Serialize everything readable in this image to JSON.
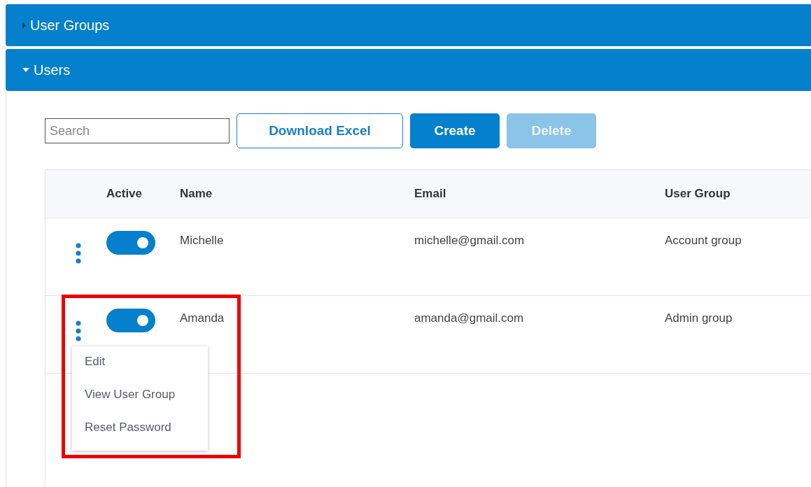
{
  "panels": [
    {
      "title": "User Groups",
      "expanded": false
    },
    {
      "title": "Users",
      "expanded": true
    }
  ],
  "toolbar": {
    "search": {
      "placeholder": "Search"
    },
    "buttons": [
      {
        "label": "Download Excel",
        "kind": "outline",
        "disabled": false
      },
      {
        "label": "Create",
        "kind": "primary",
        "disabled": false
      },
      {
        "label": "Delete",
        "kind": "primary",
        "disabled": true
      }
    ]
  },
  "table": {
    "columns": [
      "Active",
      "Name",
      "Email",
      "User Group"
    ],
    "rows": [
      {
        "active": true,
        "name": "Michelle",
        "email": "michelle@gmail.com",
        "group": "Account group",
        "highlighted": false
      },
      {
        "active": true,
        "name": "Amanda",
        "email": "amanda@gmail.com",
        "group": "Admin group",
        "highlighted": true,
        "menu": [
          "Edit",
          "View User Group",
          "Reset Password"
        ]
      }
    ]
  }
}
